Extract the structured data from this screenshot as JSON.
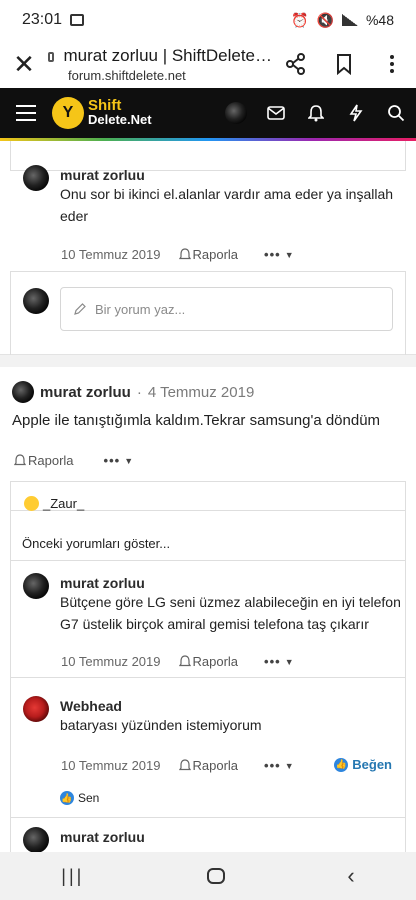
{
  "status_bar": {
    "time": "23:01",
    "battery": "%48"
  },
  "browser": {
    "title": "murat zorluu | ShiftDelete…",
    "url": "forum.shiftdelete.net"
  },
  "site": {
    "logo_line1": "Shift",
    "logo_line2": "Delete.Net",
    "logo_mark": "Y"
  },
  "comment1": {
    "author": "murat zorluu",
    "text_line1": "Onu sor bi ikinci el.alanlar vardır ama eder ya inşallah",
    "text_line2": "eder",
    "date": "10 Temmuz 2019",
    "report": "Raporla",
    "more": "•••"
  },
  "reply_input": {
    "placeholder": "Bir yorum yaz..."
  },
  "post": {
    "author": "murat zorluu",
    "separator": "·",
    "date": "4 Temmuz 2019",
    "body": "Apple ile tanıştığımla kaldım.Tekrar samsung'a döndüm",
    "report": "Raporla",
    "more": "•••"
  },
  "likers": {
    "name": "_Zaur_"
  },
  "previous_comments": "Önceki yorumları göster...",
  "comment2": {
    "author": "murat zorluu",
    "text_line1": "Bütçene göre LG seni üzmez alabileceğin en iyi telefon",
    "text_line2": "G7 üstelik birçok amiral gemisi telefona taş çıkarır",
    "date": "10 Temmuz 2019",
    "report": "Raporla",
    "more": "•••"
  },
  "comment3": {
    "author": "Webhead",
    "text": "bataryası yüzünden istemiyorum",
    "date": "10 Temmuz 2019",
    "report": "Raporla",
    "more": "•••",
    "like_label": "Beğen",
    "reaction_by": "Sen"
  },
  "comment4": {
    "author": "murat zorluu"
  },
  "colors": {
    "site_bar": "#0f0f0f",
    "brand_yellow": "#f5c518",
    "like_blue": "#2577b1"
  }
}
